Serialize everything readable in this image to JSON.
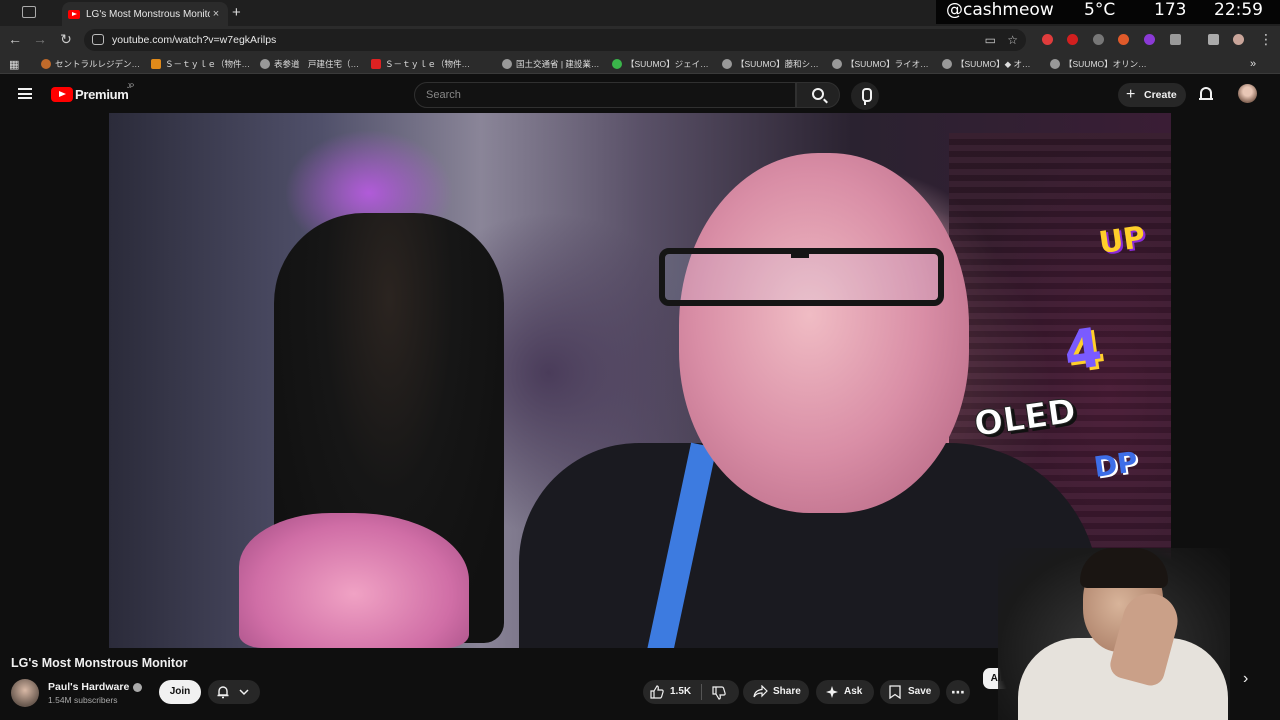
{
  "browser": {
    "tab_title": "LG's Most Monstrous Monitor",
    "tab_close": "×",
    "new_tab": "+",
    "url": "youtube.com/watch?v=w7egkArilps",
    "bookmarks": [
      "セントラルレジデン…",
      "Ｓ－ｔｙｌｅ（物件…",
      "表参道　戸建住宅（…",
      "Ｓ－ｔｙｌｅ（物件…",
      "国土交通省 | 建設業…",
      "【SUUMO】ジェイ…",
      "【SUUMO】藤和シ…",
      "【SUUMO】ライオ…",
      "【SUUMO】◆ オ…",
      "【SUUMO】オリン…"
    ],
    "bookmarks_overflow": "»"
  },
  "status_overlay": {
    "handle": "@cashmeow",
    "temperature": "5°C",
    "counter": "173",
    "time": "22:59"
  },
  "youtube": {
    "logo_text": "Premium",
    "logo_region": "JP",
    "search_placeholder": "Search",
    "create_label": "Create",
    "video": {
      "title": "LG's Most Monstrous Monitor",
      "channel_name": "Paul's Hardware",
      "subscribers": "1.54M subscribers",
      "join_label": "Join",
      "likes": "1.5K",
      "share_label": "Share",
      "ask_label": "Ask",
      "save_label": "Save",
      "more_label": "⋯"
    },
    "chips": {
      "all_label": "All"
    },
    "graffiti": [
      "UP",
      "OLED",
      "4",
      "DP"
    ]
  },
  "colors": {
    "brand_red": "#ff0000",
    "background": "#0f0f0f",
    "chip_bg": "#272727"
  }
}
